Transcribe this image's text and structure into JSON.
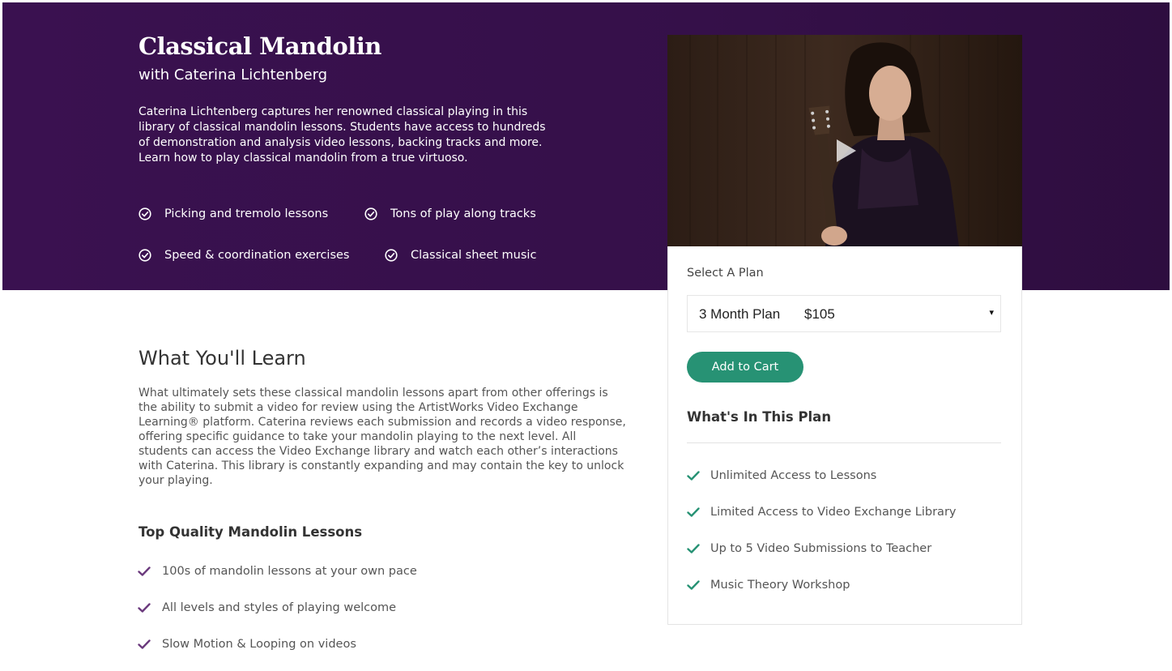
{
  "hero": {
    "title": "Classical Mandolin",
    "subtitle": "with Caterina Lichtenberg",
    "description": "Caterina Lichtenberg captures her renowned classical playing in this library of classical mandolin lessons. Students have access to hundreds of demonstration and analysis video lessons, backing tracks and more. Learn how to play classical mandolin from a true virtuoso.",
    "features": [
      "Picking and tremolo lessons",
      "Tons of play along tracks",
      "Speed & coordination exercises",
      "Classical sheet music"
    ],
    "background_color": "#371049"
  },
  "video": {
    "play_icon": "play-icon"
  },
  "plan": {
    "select_label": "Select A Plan",
    "selected_plan_name": "3 Month Plan",
    "selected_plan_price": "$105",
    "dropdown_arrow": "▾",
    "add_to_cart_label": "Add to Cart",
    "add_to_cart_color": "#279274",
    "included_heading": "What's In This Plan",
    "included_items": [
      "Unlimited Access to Lessons",
      "Limited Access to Video Exchange Library",
      "Up to 5 Video Submissions to Teacher",
      "Music Theory Workshop"
    ],
    "check_color": "#279274"
  },
  "learn": {
    "title": "What You'll Learn",
    "body": "What ultimately sets these classical mandolin lessons apart from other offerings is the ability to submit a video for review using the ArtistWorks Video Exchange Learning® platform. Caterina reviews each submission and records a video response, offering specific guidance to take your mandolin playing to the next level. All students can access the Video Exchange library and watch each other’s interactions with Caterina. This library is constantly expanding and may contain the key to unlock your playing.",
    "quality_title": "Top Quality Mandolin Lessons",
    "quality_items": [
      "100s of mandolin lessons at your own pace",
      "All levels and styles of playing welcome",
      "Slow Motion & Looping on videos"
    ],
    "check_color": "#6b3a7d"
  }
}
